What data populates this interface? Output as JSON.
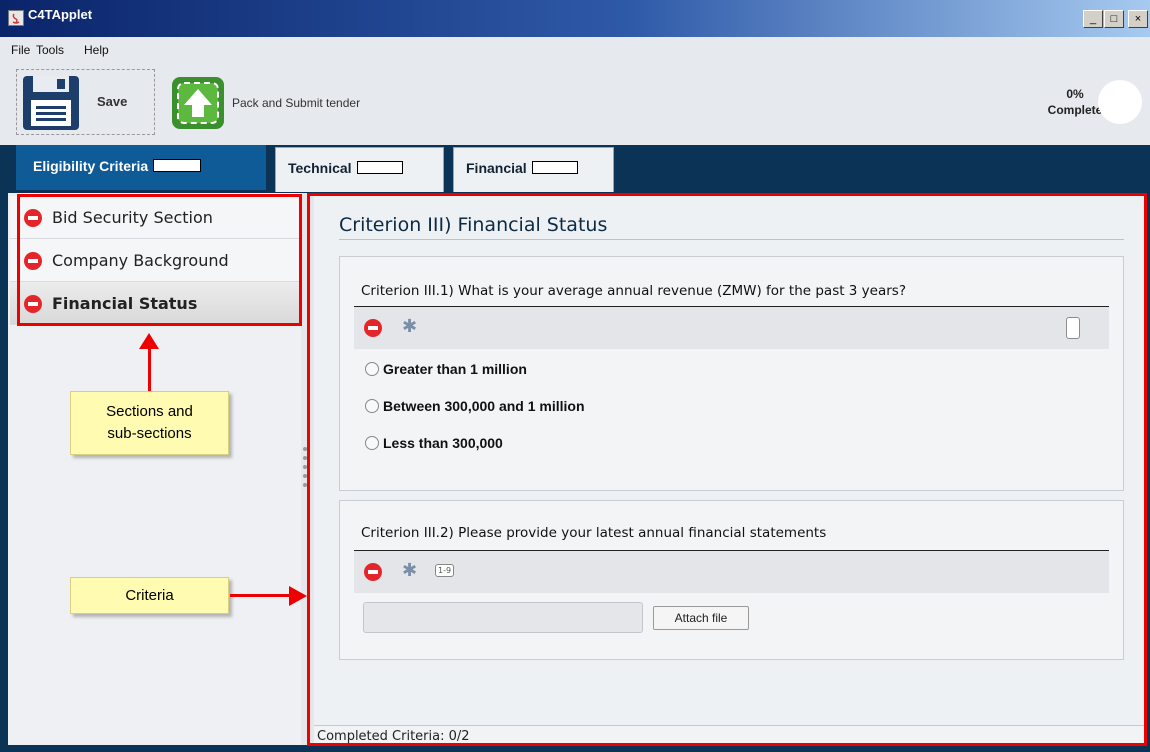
{
  "window": {
    "title": "C4TApplet",
    "min_glyph": "_",
    "max_glyph": "□",
    "close_glyph": "×"
  },
  "menu": {
    "file": "File",
    "tools": "Tools",
    "help": "Help"
  },
  "toolbar": {
    "save_label": "Save",
    "pack_label": "Pack and Submit tender"
  },
  "progress": {
    "percent_text": "0%",
    "complete_text": "Complete",
    "value": 0
  },
  "tabs": [
    {
      "label": "Eligibility Criteria",
      "active": true
    },
    {
      "label": "Technical",
      "active": false
    },
    {
      "label": "Financial",
      "active": false
    }
  ],
  "sections": [
    {
      "label": "Bid Security Section"
    },
    {
      "label": "Company Background"
    },
    {
      "label": "Financial Status",
      "selected": true
    }
  ],
  "criterion": {
    "title": "Criterion III) Financial Status",
    "q1": {
      "text": "Criterion III.1) What is your average annual revenue (ZMW) for the past 3 years?",
      "options": [
        "Greater than 1 million",
        "Between 300,000 and 1 million",
        "Less than 300,000"
      ]
    },
    "q2": {
      "text": "Criterion III.2) Please provide your latest annual financial statements",
      "attach_label": "Attach file",
      "numbering_badge": "1-9"
    }
  },
  "status": {
    "text": "Completed Criteria: 0/2"
  },
  "annotations": {
    "sections_callout": "Sections and sub-sections",
    "criteria_callout": "Criteria",
    "color": "#e00000"
  }
}
